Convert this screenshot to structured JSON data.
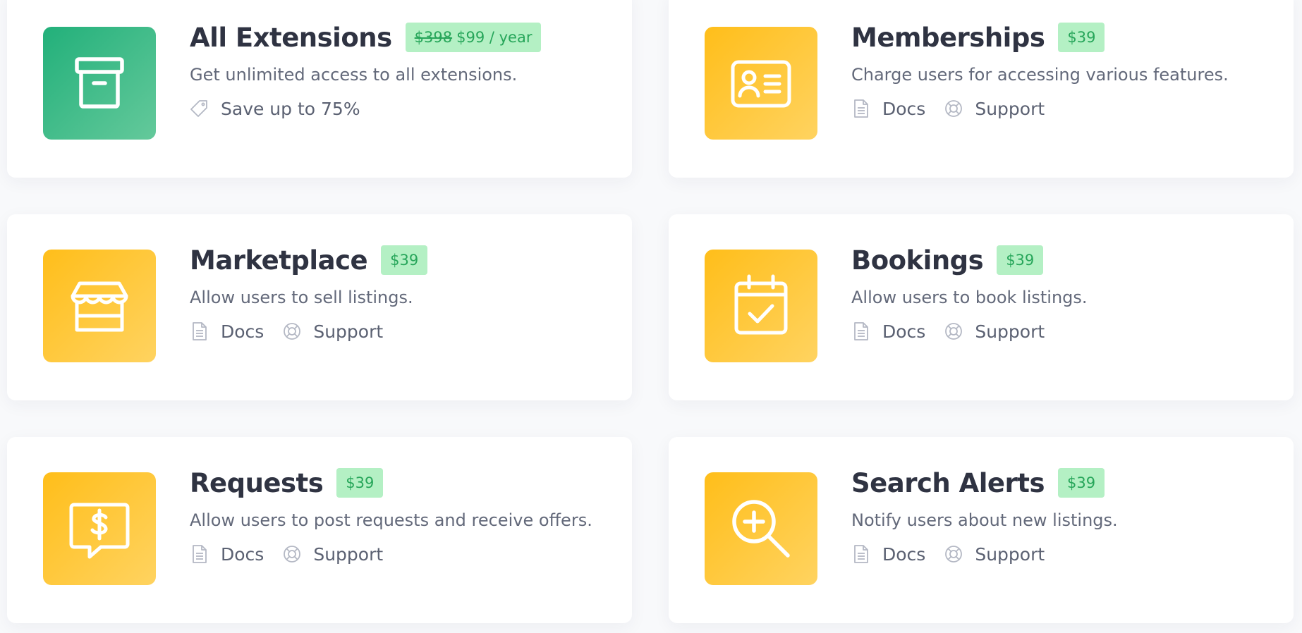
{
  "cards": [
    {
      "title": "All Extensions",
      "price_old": "$398",
      "price": "$99 / year",
      "description": "Get unlimited access to all extensions.",
      "save_text": "Save up to 75%",
      "icon": "archive-box-icon",
      "accent": "#22b07a"
    },
    {
      "title": "Memberships",
      "price": "$39",
      "description": "Charge users for accessing various features.",
      "docs_label": "Docs",
      "support_label": "Support",
      "icon": "id-card-icon",
      "accent": "#ffbe1a"
    },
    {
      "title": "Marketplace",
      "price": "$39",
      "description": "Allow users to sell listings.",
      "docs_label": "Docs",
      "support_label": "Support",
      "icon": "storefront-icon",
      "accent": "#ffbe1a"
    },
    {
      "title": "Bookings",
      "price": "$39",
      "description": "Allow users to book listings.",
      "docs_label": "Docs",
      "support_label": "Support",
      "icon": "calendar-check-icon",
      "accent": "#ffbe1a"
    },
    {
      "title": "Requests",
      "price": "$39",
      "description": "Allow users to post requests and receive offers.",
      "docs_label": "Docs",
      "support_label": "Support",
      "icon": "chat-dollar-icon",
      "accent": "#ffbe1a"
    },
    {
      "title": "Search Alerts",
      "price": "$39",
      "description": "Notify users about new listings.",
      "docs_label": "Docs",
      "support_label": "Support",
      "icon": "zoom-plus-icon",
      "accent": "#ffbe1a"
    }
  ],
  "colors": {
    "badge_bg": "#b4f0c4",
    "badge_text": "#27a65a",
    "title": "#2f3342",
    "muted": "#63697a"
  }
}
